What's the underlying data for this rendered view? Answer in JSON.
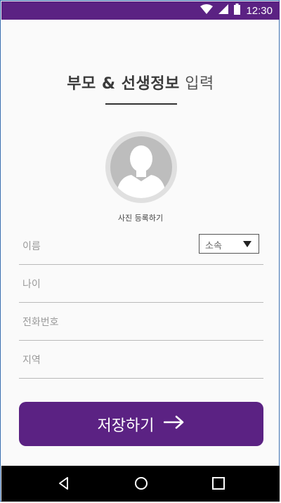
{
  "status_bar": {
    "time": "12:30",
    "icons": [
      "wifi-icon",
      "signal-icon",
      "battery-icon"
    ]
  },
  "page": {
    "title_bold": "부모 & 선생정보",
    "title_light": "입력"
  },
  "photo": {
    "label": "사진 등록하기"
  },
  "form": {
    "fields": [
      {
        "label": "이름"
      },
      {
        "label": "나이"
      },
      {
        "label": "전화번호"
      },
      {
        "label": "지역"
      }
    ],
    "affiliation_select": {
      "value": "소속"
    }
  },
  "save_button": {
    "label": "저장하기",
    "icon": "arrow-right-icon"
  },
  "nav_bar": {
    "items": [
      "back-icon",
      "home-icon",
      "recents-icon"
    ]
  },
  "colors": {
    "accent": "#5b2283",
    "nav": "#000000",
    "frame": "#3a6fb0"
  }
}
